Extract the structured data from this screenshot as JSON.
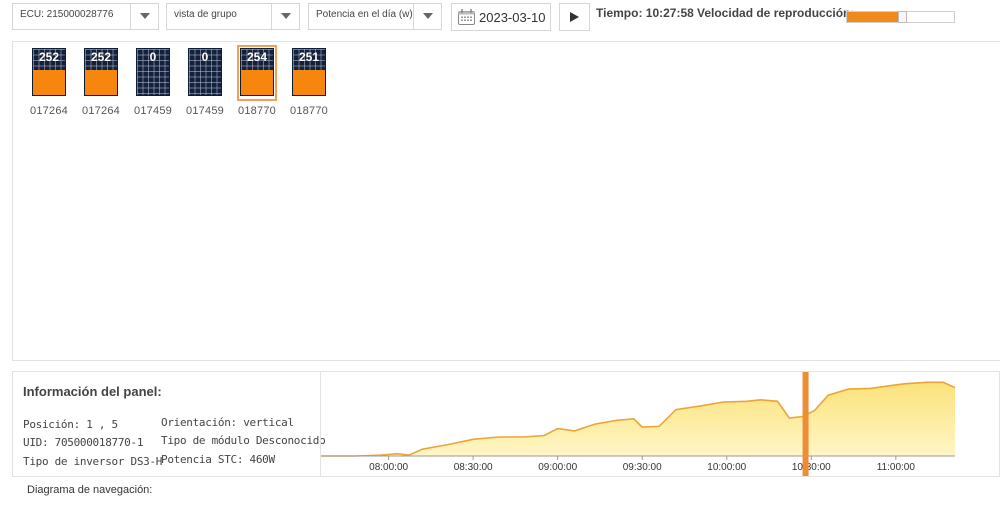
{
  "toolbar": {
    "ecu_select": "ECU: 215000028776",
    "view_select": "vista de grupo",
    "metric_select": "Potencia en el día (w)",
    "date": "2023-03-10",
    "time_label": "Tiempo: 10:27:58",
    "speed_label": "Velocidad de reproducción:",
    "speed_level": 0.52,
    "play_icon": "play-icon",
    "calendar_icon": "calendar-icon",
    "dropdown_icon": "chevron-down-icon",
    "accent_color": "#f7860f"
  },
  "modules": [
    {
      "value": "252",
      "id": "017264",
      "fill": 0.55,
      "selected": false
    },
    {
      "value": "252",
      "id": "017264",
      "fill": 0.55,
      "selected": false
    },
    {
      "value": "0",
      "id": "017459",
      "fill": 0.0,
      "selected": false
    },
    {
      "value": "0",
      "id": "017459",
      "fill": 0.0,
      "selected": false
    },
    {
      "value": "254",
      "id": "018770",
      "fill": 0.55,
      "selected": true
    },
    {
      "value": "251",
      "id": "018770",
      "fill": 0.55,
      "selected": false
    }
  ],
  "info": {
    "title": "Información del panel:",
    "posicion_key": "Posición:",
    "posicion_val": "1 , 5",
    "uid_key": "UID:",
    "uid_val": "705000018770-1",
    "inversor_key": "Tipo de inversor",
    "inversor_val": "DS3-H",
    "orientacion_key": "Orientación:",
    "orientacion_val": "vertical",
    "modulo_key": "Tipo de módulo",
    "modulo_val": "Desconocido",
    "potencia_key": "Potencia STC:",
    "potencia_val": "460W"
  },
  "chart_data": {
    "type": "area",
    "xlabel": "",
    "ylabel": "",
    "x_ticks": [
      "08:00:00",
      "08:30:00",
      "09:00:00",
      "09:30:00",
      "10:00:00",
      "10:30:00",
      "11:00:00"
    ],
    "x_range_minutes": [
      7.6,
      11.35
    ],
    "cursor_time": "10:27:58",
    "points": [
      [
        7.6,
        0
      ],
      [
        7.8,
        0
      ],
      [
        7.95,
        1
      ],
      [
        8.05,
        3
      ],
      [
        8.12,
        1
      ],
      [
        8.2,
        9
      ],
      [
        8.35,
        15
      ],
      [
        8.5,
        22
      ],
      [
        8.65,
        25
      ],
      [
        8.8,
        25
      ],
      [
        8.92,
        27
      ],
      [
        9.0,
        36
      ],
      [
        9.1,
        33
      ],
      [
        9.22,
        42
      ],
      [
        9.35,
        47
      ],
      [
        9.45,
        49
      ],
      [
        9.5,
        38
      ],
      [
        9.6,
        39
      ],
      [
        9.7,
        61
      ],
      [
        9.85,
        66
      ],
      [
        9.98,
        71
      ],
      [
        10.12,
        72
      ],
      [
        10.2,
        74
      ],
      [
        10.3,
        72
      ],
      [
        10.37,
        50
      ],
      [
        10.45,
        52
      ],
      [
        10.52,
        60
      ],
      [
        10.6,
        80
      ],
      [
        10.72,
        88
      ],
      [
        10.85,
        89
      ],
      [
        10.98,
        93
      ],
      [
        11.05,
        95
      ],
      [
        11.18,
        97
      ],
      [
        11.28,
        97
      ],
      [
        11.35,
        90
      ]
    ],
    "y_range": [
      0,
      100
    ],
    "line_color": "#eda437",
    "fill_color": "#fff6c7",
    "cursor_color": "#ee8d35"
  },
  "navigation": {
    "label": "Diagrama de navegación:"
  }
}
